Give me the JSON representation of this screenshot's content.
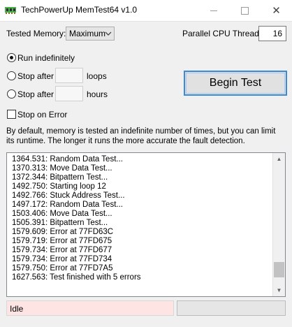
{
  "window": {
    "title": "TechPowerUp MemTest64 v1.0",
    "close_glyph": "✕"
  },
  "settings": {
    "tested_memory_label": "Tested Memory:",
    "tested_memory_value": "Maximum",
    "threads_label": "Parallel CPU Threads:",
    "threads_value": "16"
  },
  "run_options": {
    "run_indefinitely": "Run indefinitely",
    "stop_after": "Stop after",
    "loops": "loops",
    "hours": "hours",
    "stop_on_error": "Stop on Error",
    "selected": "run_indefinitely"
  },
  "begin_button": "Begin Test",
  "description": "By default, memory is tested an indefinite number of times, but you can limit its runtime. The longer it runs the more accurate the fault detection.",
  "log": [
    "1364.531: Random Data Test...",
    "1370.313: Move Data Test...",
    "1372.344: Bitpattern Test...",
    "1492.750: Starting loop 12",
    "1492.766: Stuck Address Test...",
    "1497.172: Random Data Test...",
    "1503.406: Move Data Test...",
    "1505.391: Bitpattern Test...",
    "1579.609: Error at 77FD63C",
    "1579.719: Error at 77FD675",
    "1579.734: Error at 77FD677",
    "1579.734: Error at 77FD734",
    "1579.750: Error at 77FD7A5",
    "1627.563: Test finished with 5 errors"
  ],
  "scroll_position": 0.93,
  "status": {
    "text": "Idle",
    "color": "#ffe4e4"
  },
  "colors": {
    "accent": "#3c8ad7"
  }
}
